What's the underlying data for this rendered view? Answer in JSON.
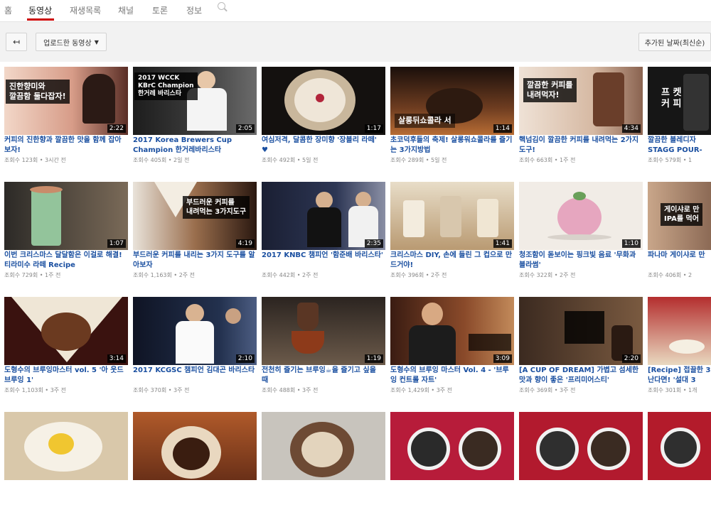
{
  "tabs": [
    "홈",
    "동영상",
    "재생목록",
    "채널",
    "토론",
    "정보"
  ],
  "toolbar": {
    "back_label": "↤",
    "upload_label": "업로드한 동영상",
    "sort_label": "추가된 날짜(최신순)"
  },
  "videos": [
    {
      "title": "커피의 진한향과 깔끔한 맛을 함께 잡아보자!",
      "meta": "조회수 123회 • 3시간 전",
      "duration": "2:22",
      "overlay": "진한향미와\n깔끔함 둘다잡자!"
    },
    {
      "title": "2017 Korea Brewers Cup Champion 한거레바리스타",
      "meta": "조회수 405회 • 2일 전",
      "duration": "2:05",
      "overlay": "2017 WCCK\nKBrC Champion\n한거레 바리스타"
    },
    {
      "title": "여심저격, 달콤한 장미향 '장블리 라떼' ♥",
      "meta": "조회수 492회 • 5일 전",
      "duration": "1:17",
      "overlay": ""
    },
    {
      "title": "초코덕후들의 축제! 살롱워쇼콜라를 즐기는 3가지방법",
      "meta": "조회수 289회 • 5일 전",
      "duration": "1:14",
      "overlay": "살롱뒤쇼콜라 서"
    },
    {
      "title": "핵넘김이 깔끔한 커피를 내려먹는 2가지 도구!",
      "meta": "조회수 663회 • 1주 전",
      "duration": "4:34",
      "overlay": "깔끔한 커피를\n내려먹자!"
    },
    {
      "title": "깔끔한 블레디자 STAGG POUR-OV",
      "meta": "조회수 579회 • 1",
      "duration": "",
      "overlay": "프 켓\n커 피"
    },
    {
      "title": "이번 크리스마스 달달함은 이걸로 해결! 티라미수 라떼 Recipe",
      "meta": "조회수 729회 • 1주 전",
      "duration": "1:07",
      "overlay": ""
    },
    {
      "title": "부드러운 커피를 내리는 3가지 도구를 알아보자",
      "meta": "조회수 1,163회 • 2주 전",
      "duration": "4:19",
      "overlay": "부드러운 커피를\n내려먹는 3가지도구"
    },
    {
      "title": "2017 KNBC 챔피언 '함준배 바리스타'",
      "meta": "조회수 442회 • 2주 전",
      "duration": "2:35",
      "overlay": ""
    },
    {
      "title": "크리스마스 DIY, 손에 들린 그 컵으로 만드거야!",
      "meta": "조회수 396회 • 2주 전",
      "duration": "1:41",
      "overlay": ""
    },
    {
      "title": "청조함이 돋보이는 핑크빛 음료 '무화과 블라썸'",
      "meta": "조회수 322회 • 2주 전",
      "duration": "1:10",
      "overlay": ""
    },
    {
      "title": "파나마 게이샤로 만",
      "meta": "조회수 406회 • 2",
      "duration": "",
      "overlay": "게이샤로 만\nIPA를 먹어"
    },
    {
      "title": "도형수의 브루잉마스터 vol. 5 '아 웃드브루잉 1'",
      "meta": "조회수 1,103회 • 3주 전",
      "duration": "3:14",
      "overlay": ""
    },
    {
      "title": "2017 KCGSC 챔피언 김대곤 바리스타",
      "meta": "조회수 370회 • 3주 전",
      "duration": "2:10",
      "overlay": ""
    },
    {
      "title": "전천히 즐기는 브루잉☕을 즐기고 싶을 때",
      "meta": "조회수 488회 • 3주 전",
      "duration": "1:19",
      "overlay": ""
    },
    {
      "title": "도형수의 브루잉 마스터 Vol. 4 - '브루잉 컨트롤 자트'",
      "meta": "조회수 1,429회 • 3주 전",
      "duration": "3:09",
      "overlay": ""
    },
    {
      "title": "[A CUP OF DREAM] 가볍고 섬세한 맛과 향이 좋은 '프리미어스티'",
      "meta": "조회수 369회 • 3주 전",
      "duration": "2:20",
      "overlay": ""
    },
    {
      "title": "[Recipe] 접끌한 3 난다면! '설대 3",
      "meta": "조회수 301회 • 1개",
      "duration": "",
      "overlay": ""
    },
    {
      "title": "",
      "meta": "",
      "duration": "",
      "overlay": ""
    },
    {
      "title": "",
      "meta": "",
      "duration": "",
      "overlay": ""
    },
    {
      "title": "",
      "meta": "",
      "duration": "",
      "overlay": ""
    },
    {
      "title": "",
      "meta": "",
      "duration": "",
      "overlay": ""
    },
    {
      "title": "",
      "meta": "",
      "duration": "",
      "overlay": ""
    },
    {
      "title": "",
      "meta": "",
      "duration": "",
      "overlay": ""
    }
  ]
}
